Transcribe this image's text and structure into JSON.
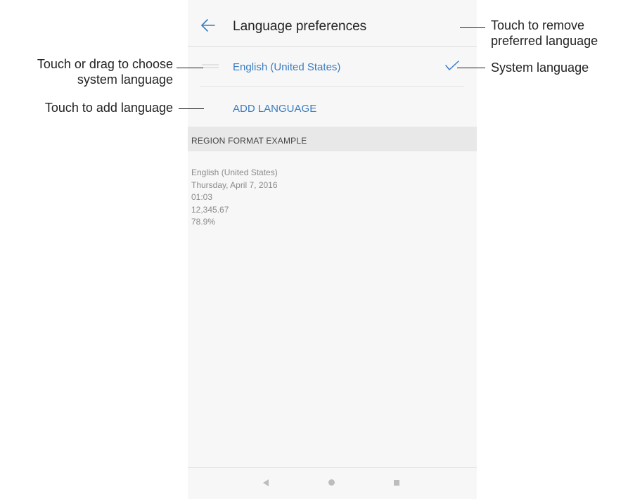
{
  "screen": {
    "app_bar": {
      "back_icon": "arrow-left-icon",
      "title": "Language preferences"
    },
    "language_list": {
      "items": [
        {
          "label": "English (United States)",
          "drag_handle_icon": "drag-handle-icon",
          "selected_icon": "checkmark-icon",
          "selected": true
        }
      ],
      "add_language_label": "ADD LANGUAGE"
    },
    "region_format": {
      "header": "REGION FORMAT EXAMPLE",
      "examples": [
        "English (United States)",
        "Thursday, April 7, 2016",
        "01:03",
        "12,345.67",
        "78.9%"
      ]
    },
    "nav_bar": {
      "back_icon": "triangle-back-icon",
      "home_icon": "circle-home-icon",
      "recents_icon": "square-recents-icon"
    }
  },
  "callouts": {
    "remove_preferred": [
      "Touch to remove",
      "preferred language"
    ],
    "system_language": "System language",
    "choose_system": [
      "Touch or drag to choose",
      "system language"
    ],
    "add_language": "Touch to add language"
  },
  "colors": {
    "accent": "#3a7cc1",
    "screen_background": "#f7f7f7",
    "section_header_background": "#e8e8e8",
    "secondary_text": "#8a8a8a",
    "nav_icons": "#bdbdbd"
  }
}
